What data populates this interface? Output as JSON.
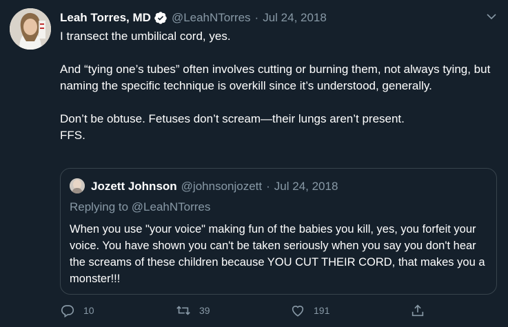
{
  "tweet": {
    "author_name": "Leah Torres, MD",
    "handle": "@LeahNTorres",
    "separator": "·",
    "date": "Jul 24, 2018",
    "paragraphs": [
      "I transect the umbilical cord, yes.",
      "And “tying one’s tubes” often involves cutting or burning them, not always tying, but naming the specific technique is overkill since it’s understood, generally.",
      "Don’t be obtuse. Fetuses don’t scream—their lungs aren’t present.",
      "FFS."
    ]
  },
  "quote": {
    "author_name": "Jozett Johnson",
    "handle": "@johnsonjozett",
    "separator": "·",
    "date": "Jul 24, 2018",
    "replying_prefix": "Replying to",
    "replying_to": "@LeahNTorres",
    "text": "When you use \"your voice\" making fun of the babies you kill, yes, you forfeit your voice. You have shown you can't be taken seriously when you say you don't hear the screams of these children because YOU CUT THEIR CORD, that makes you a monster!!!"
  },
  "actions": {
    "replies": "10",
    "retweets": "39",
    "likes": "191"
  },
  "icons": {
    "verified": "verified-badge-icon",
    "caret": "chevron-down-icon",
    "reply": "reply-icon",
    "retweet": "retweet-icon",
    "like": "heart-icon",
    "share": "share-icon"
  },
  "colors": {
    "background": "#15202b",
    "text": "#ffffff",
    "secondary": "#8899a6",
    "border": "#38444d",
    "verified": "#ffffff"
  }
}
